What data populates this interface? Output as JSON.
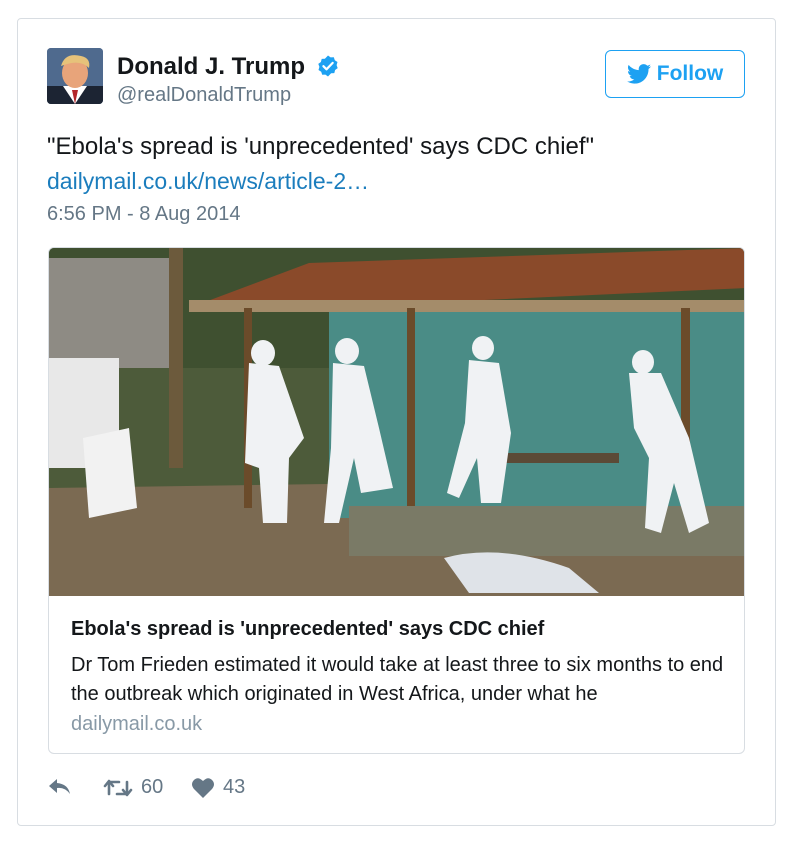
{
  "user": {
    "name": "Donald J. Trump",
    "handle": "@realDonaldTrump",
    "verified": true
  },
  "follow_label": "Follow",
  "tweet": {
    "text": "\"Ebola's spread is 'unprecedented' says CDC chief\"",
    "link": "dailymail.co.uk/news/article-2…",
    "timestamp": "6:56 PM - 8 Aug 2014"
  },
  "link_card": {
    "title": "Ebola's spread is 'unprecedented' says CDC chief",
    "description": "Dr Tom Frieden estimated it would take at least three to six months to end the outbreak which originated in West Africa, under what he",
    "domain": "dailymail.co.uk"
  },
  "actions": {
    "reply_icon": "reply-icon",
    "retweet_icon": "retweet-icon",
    "like_icon": "heart-icon",
    "retweets": "60",
    "likes": "43"
  },
  "colors": {
    "accent": "#1da1f2",
    "link": "#1b7dbd",
    "muted": "#657786",
    "border": "#d8dde2"
  }
}
